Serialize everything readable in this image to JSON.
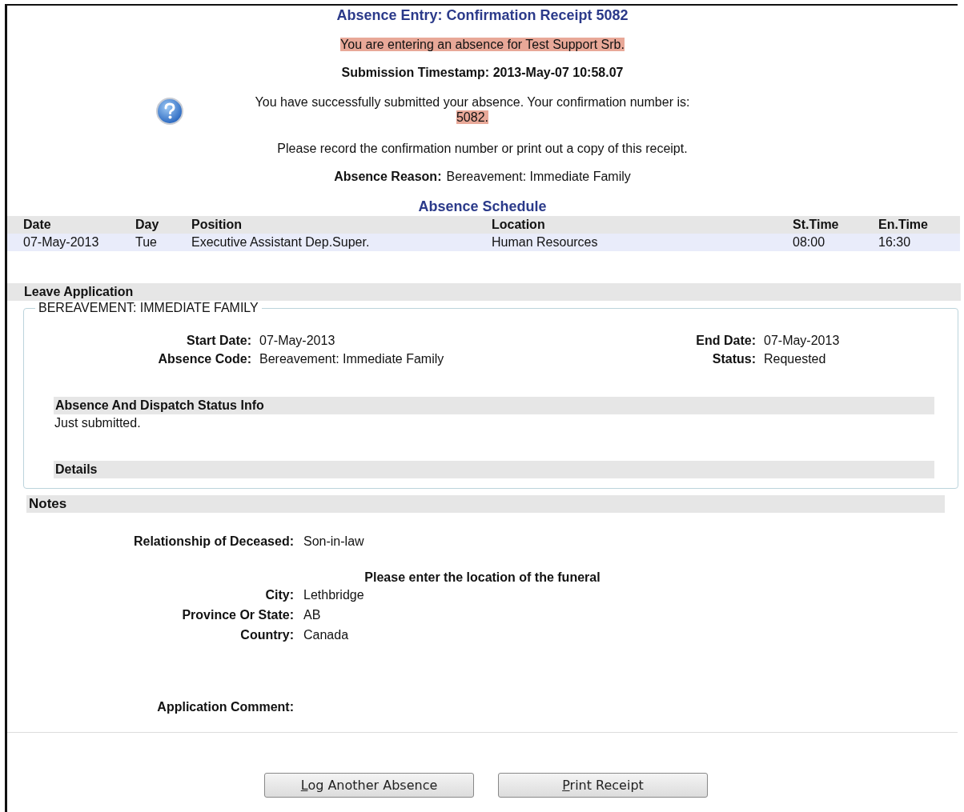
{
  "title": "Absence Entry: Confirmation Receipt 5082",
  "entering_notice": "You are entering an absence for Test Support Srb.",
  "timestamp": "Submission Timestamp: 2013-May-07 10:58.07",
  "success_message": "You have successfully submitted your absence. Your confirmation number is:",
  "confirmation_number": "5082.",
  "record_message": "Please record the confirmation number or print out a copy of this receipt.",
  "absence_reason": {
    "label": "Absence Reason:",
    "value": "Bereavement: Immediate Family"
  },
  "schedule": {
    "title": "Absence Schedule",
    "columns": [
      "Date",
      "Day",
      "Position",
      "Location",
      "St.Time",
      "En.Time"
    ],
    "rows": [
      [
        "07-May-2013",
        "Tue",
        "Executive Assistant Dep.Super.",
        "Human Resources",
        "08:00",
        "16:30"
      ]
    ]
  },
  "leave_application": {
    "heading": "Leave Application",
    "legend": "BEREAVEMENT: IMMEDIATE FAMILY",
    "left_fields": [
      {
        "label": "Start Date:",
        "value": "07-May-2013"
      },
      {
        "label": "Absence Code:",
        "value": "Bereavement: Immediate Family"
      }
    ],
    "right_fields": [
      {
        "label": "End Date:",
        "value": "07-May-2013"
      },
      {
        "label": "Status:",
        "value": "Requested"
      }
    ],
    "status_info_heading": "Absence And Dispatch Status Info",
    "status_info": "Just submitted.",
    "details_heading": "Details"
  },
  "notes": {
    "heading": "Notes",
    "relationship": {
      "label": "Relationship of Deceased:",
      "value": "Son-in-law"
    },
    "funeral_prompt": "Please enter the location of the funeral",
    "location_fields": [
      {
        "label": "City:",
        "value": "Lethbridge"
      },
      {
        "label": "Province Or State:",
        "value": "AB"
      },
      {
        "label": "Country:",
        "value": "Canada"
      }
    ],
    "comment_label": "Application Comment:"
  },
  "buttons": [
    {
      "key": "L",
      "rest": "og Another Absence"
    },
    {
      "key": "P",
      "rest": "rint Receipt"
    }
  ]
}
